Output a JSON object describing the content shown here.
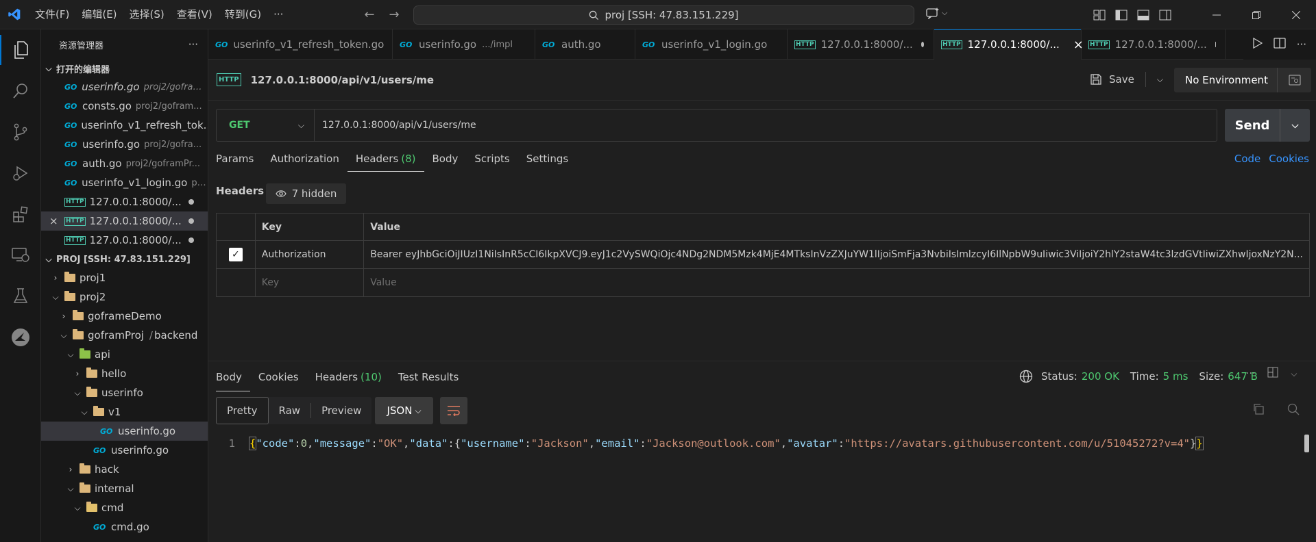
{
  "titlebar": {
    "menu": [
      "文件(F)",
      "编辑(E)",
      "选择(S)",
      "查看(V)",
      "转到(G)",
      "···"
    ],
    "search": "proj [SSH: 47.83.151.229]"
  },
  "sidebar": {
    "title": "资源管理器",
    "more": "···",
    "open_editors_title": "打开的编辑器",
    "open_editors": [
      {
        "name": "userinfo.go",
        "path": "proj2/gofram...",
        "italic": true
      },
      {
        "name": "consts.go",
        "path": "proj2/gofram..."
      },
      {
        "name": "userinfo_v1_refresh_tok...",
        "path": ""
      },
      {
        "name": "userinfo.go",
        "path": "proj2/gofra..."
      },
      {
        "name": "auth.go",
        "path": "proj2/goframPr..."
      },
      {
        "name": "userinfo_v1_login.go",
        "path": "pr..."
      },
      {
        "name": "127.0.0.1:8000/...",
        "path": ""
      },
      {
        "name": "127.0.0.1:8000/...",
        "path": ""
      },
      {
        "name": "127.0.0.1:8000/...",
        "path": ""
      }
    ],
    "workspace_title": "PROJ [SSH: 47.83.151.229]",
    "tree": [
      {
        "label": "proj1"
      },
      {
        "label": "proj2"
      },
      {
        "label": "goframeDemo"
      },
      {
        "label": "goframProj",
        "label2": "backend",
        "sep": "/"
      },
      {
        "label": "api"
      },
      {
        "label": "hello"
      },
      {
        "label": "userinfo"
      },
      {
        "label": "v1"
      },
      {
        "label": "userinfo.go"
      },
      {
        "label": "userinfo.go"
      },
      {
        "label": "hack"
      },
      {
        "label": "internal"
      },
      {
        "label": "cmd"
      },
      {
        "label": "cmd.go"
      }
    ]
  },
  "tabs": [
    {
      "label": "userinfo_v1_refresh_token.go",
      "desc": ""
    },
    {
      "label": "userinfo.go",
      "desc": ".../impl"
    },
    {
      "label": "auth.go",
      "desc": ""
    },
    {
      "label": "userinfo_v1_login.go",
      "desc": ""
    },
    {
      "label": "127.0.0.1:8000/...",
      "desc": ""
    },
    {
      "label": "127.0.0.1:8000/...",
      "desc": ""
    },
    {
      "label": "127.0.0.1:8000/...",
      "desc": ""
    }
  ],
  "icons": {
    "go": "GO",
    "http": "HTTP",
    "close": "×",
    "check": "✓"
  },
  "request": {
    "title": "127.0.0.1:8000/api/v1/users/me",
    "save_label": "Save",
    "environment": "No Environment",
    "method": "GET",
    "url": "127.0.0.1:8000/api/v1/users/me",
    "send_label": "Send",
    "tabs": {
      "params": "Params",
      "authorization": "Authorization",
      "headers": "Headers",
      "headers_count": "(8)",
      "body": "Body",
      "scripts": "Scripts",
      "settings": "Settings"
    },
    "code_link": "Code",
    "cookies_link": "Cookies",
    "headers_label": "Headers",
    "hidden_label": "7 hidden",
    "table": {
      "key_header": "Key",
      "value_header": "Value",
      "rows": [
        {
          "key": "Authorization",
          "value": "Bearer eyJhbGciOiJIUzI1NiIsInR5cCI6IkpXVCJ9.eyJ1c2VySWQiOjc4NDg2NDM5Mzk4MjE4MTksInVzZXJuYW1lIjoiSmFja3NvbiIsImlzcyI6IlNpbW9uIiwic3ViIjoiY2hlY2staW4tc3lzdGVtIiwiZXhwIjoxNzY2N..."
        }
      ],
      "key_placeholder": "Key",
      "value_placeholder": "Value"
    }
  },
  "response": {
    "tabs": {
      "body": "Body",
      "cookies": "Cookies",
      "headers": "Headers",
      "headers_count": "(10)",
      "test_results": "Test Results"
    },
    "status_label": "Status:",
    "status_value": "200 OK",
    "time_label": "Time:",
    "time_value": "5 ms",
    "size_label": "Size:",
    "size_value": "647 B",
    "more": "···",
    "views": {
      "pretty": "Pretty",
      "raw": "Raw",
      "preview": "Preview"
    },
    "format": "JSON",
    "line_number": "1",
    "json": {
      "open": "{",
      "code_key": "\"code\"",
      "code_val": "0",
      "message_key": "\"message\"",
      "message_val": "\"OK\"",
      "data_key": "\"data\"",
      "inner_open": "{",
      "username_key": "\"username\"",
      "username_val": "\"Jackson\"",
      "email_key": "\"email\"",
      "email_val": "\"Jackson@outlook.com\"",
      "avatar_key": "\"avatar\"",
      "avatar_val": "\"https://avatars.githubusercontent.com/u/51045272?v=4\"",
      "inner_close": "}",
      "close": "}"
    }
  }
}
